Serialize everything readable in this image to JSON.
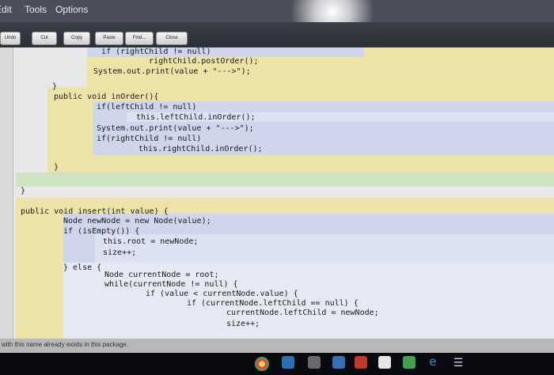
{
  "menu": {
    "edit": "Edit",
    "tools": "Tools",
    "options": "Options"
  },
  "toolbar": {
    "undo": "Undo",
    "cut": "Cut",
    "copy": "Copy",
    "paste": "Paste",
    "find": "Find...",
    "close": "Close"
  },
  "code": {
    "l1": "   if (rightChild != null)",
    "l2": "   rightChild.postOrder();",
    "l3": "System.out.print(value + \"--->\");",
    "l4": "}",
    "l5": "public void inOrder(){",
    "l6": "if(leftChild != null)",
    "l7": "this.leftChild.inOrder();",
    "l8": "System.out.print(value + \"--->\");",
    "l9": "if(rightChild != null)",
    "l10": "this.rightChild.inOrder();",
    "l11": "}",
    "l12": "}",
    "l13": "public void insert(int value) {",
    "l14": "Node newNode = new Node(value);",
    "l15": "if (isEmpty()) {",
    "l16": "this.root = newNode;",
    "l17": "size++;",
    "l18": "} else {",
    "l19": "Node currentNode = root;",
    "l20": "while(currentNode != null) {",
    "l21": "if (value < currentNode.value) {",
    "l22": "if (currentNode.leftChild == null) {",
    "l23": "currentNode.leftChild = newNode;",
    "l24": "size++;"
  },
  "status": {
    "message": "with this name already exists in this package."
  },
  "colors": {
    "yellow_band": "#ece3a7",
    "blue_band": "#cfd6ec",
    "green_band": "#cfe3c3"
  }
}
